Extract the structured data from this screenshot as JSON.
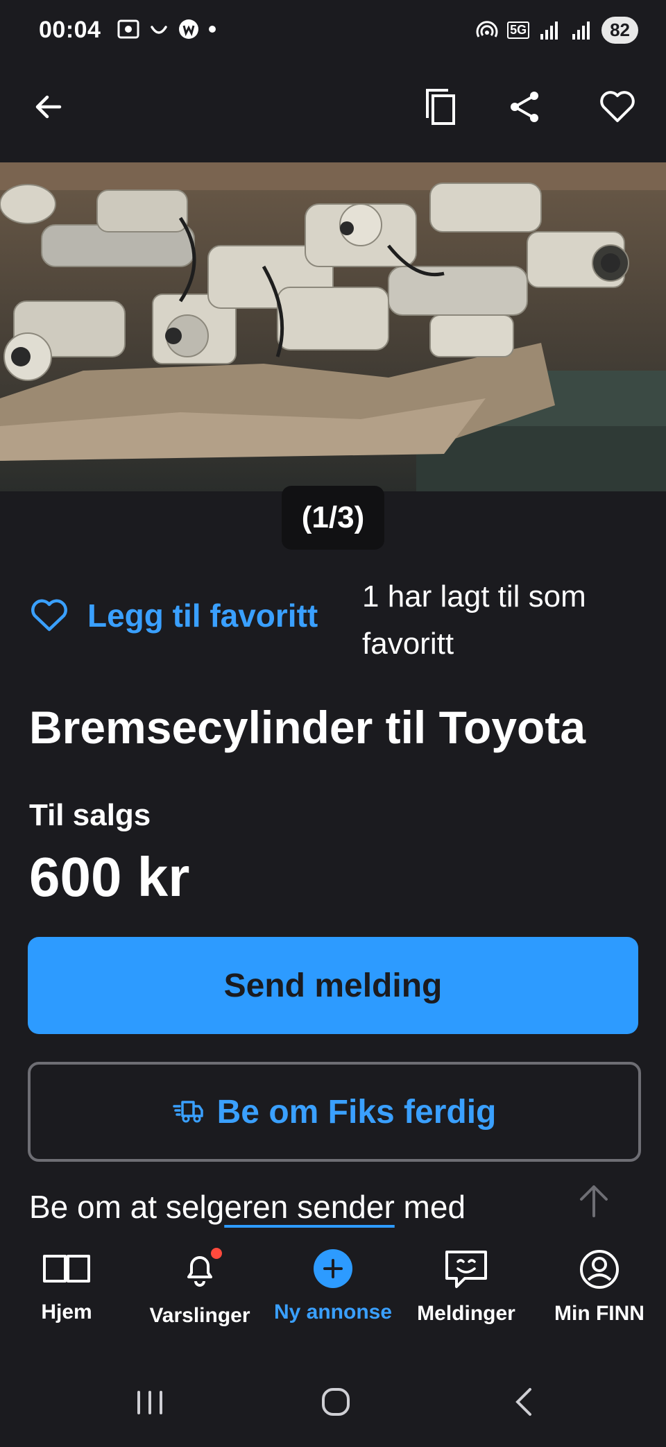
{
  "status_bar": {
    "time": "00:04",
    "network": "5G",
    "battery": "82"
  },
  "top_bar": {
    "back_icon": "arrow-left-icon",
    "copy_icon": "copy-icon",
    "share_icon": "share-icon",
    "favorite_icon": "heart-icon"
  },
  "gallery": {
    "counter": "(1/3)"
  },
  "favorite": {
    "label": "Legg til favoritt",
    "count_text": "1 har lagt til som favoritt"
  },
  "listing": {
    "title": "Bremsecylinder til Toyota",
    "status": "Til salgs",
    "price": "600 kr"
  },
  "actions": {
    "send_message": "Send melding",
    "fiks_ferdig": "Be om Fiks ferdig"
  },
  "shipping": {
    "text_before": "Be om at selg",
    "text_underlined": "eren sender",
    "text_after": " med"
  },
  "bottom_nav": {
    "items": [
      {
        "label": "Hjem",
        "icon": "book-icon"
      },
      {
        "label": "Varslinger",
        "icon": "bell-icon"
      },
      {
        "label": "Ny annonse",
        "icon": "plus-circle-icon"
      },
      {
        "label": "Meldinger",
        "icon": "chat-icon"
      },
      {
        "label": "Min FINN",
        "icon": "profile-icon"
      }
    ]
  },
  "colors": {
    "background": "#1b1b1f",
    "accent": "#2d9bff",
    "notification": "#ff4a3d"
  }
}
